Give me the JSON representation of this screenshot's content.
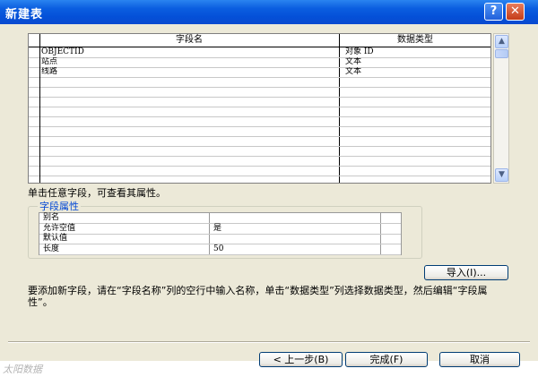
{
  "window": {
    "title": "新建表",
    "help_glyph": "?",
    "close_glyph": "✕"
  },
  "grid": {
    "columns": {
      "name": "字段名",
      "type": "数据类型"
    },
    "rows": [
      {
        "name": "OBJECTID",
        "type": "对象 ID"
      },
      {
        "name": "站点",
        "type": "文本"
      },
      {
        "name": "线路",
        "type": "文本"
      },
      {
        "name": "",
        "type": ""
      },
      {
        "name": "",
        "type": ""
      },
      {
        "name": "",
        "type": ""
      },
      {
        "name": "",
        "type": ""
      },
      {
        "name": "",
        "type": ""
      },
      {
        "name": "",
        "type": ""
      },
      {
        "name": "",
        "type": ""
      },
      {
        "name": "",
        "type": ""
      },
      {
        "name": "",
        "type": ""
      },
      {
        "name": "",
        "type": ""
      },
      {
        "name": "",
        "type": ""
      }
    ],
    "scroll_up_glyph": "▲",
    "scroll_down_glyph": "▼"
  },
  "hint": "单击任意字段，可查看其属性。",
  "properties": {
    "legend": "字段属性",
    "rows": [
      {
        "name": "别名",
        "value": ""
      },
      {
        "name": "允许空值",
        "value": "是"
      },
      {
        "name": "默认值",
        "value": ""
      },
      {
        "name": "长度",
        "value": "50"
      }
    ]
  },
  "import_label": "导入(I)...",
  "instruction": "要添加新字段，请在“字段名称”列的空行中输入名称，单击“数据类型”列选择数据类型，然后编辑“字段属性”。",
  "buttons": {
    "back": "< 上一步(B)",
    "finish": "完成(F)",
    "cancel": "取消"
  },
  "watermark": "太阳数据"
}
